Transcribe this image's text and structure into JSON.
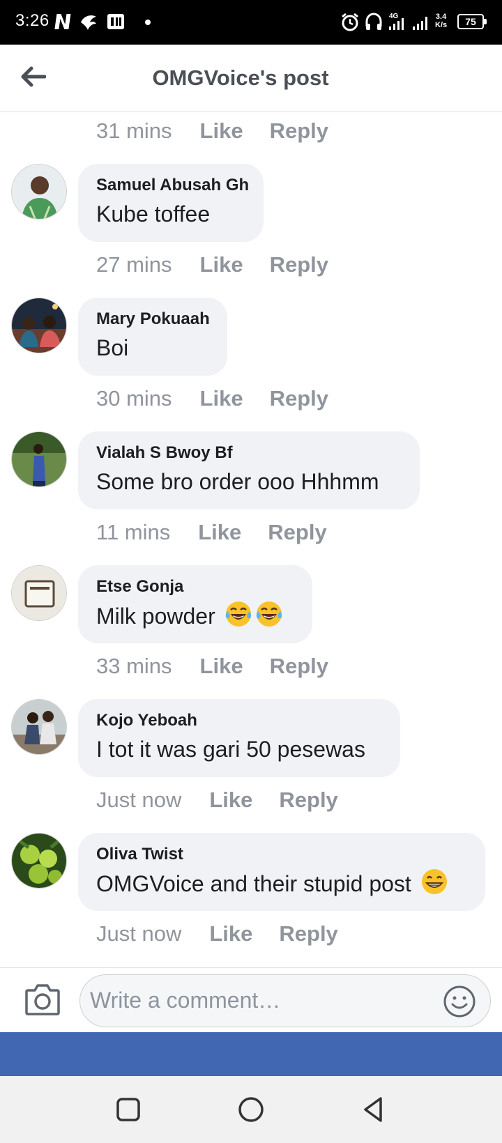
{
  "status_bar": {
    "time": "3:26",
    "network_type": "4G",
    "speed": "3.4",
    "speed_unit": "K/s",
    "battery": "75"
  },
  "header": {
    "title": "OMGVoice's post",
    "back_icon": "arrow-left-icon"
  },
  "top_meta": {
    "time": "31 mins",
    "like": "Like",
    "reply": "Reply"
  },
  "comments": [
    {
      "author": "Samuel Abusah Gh",
      "text": "Kube toffee",
      "time": "27 mins",
      "like": "Like",
      "reply": "Reply",
      "emojis": []
    },
    {
      "author": "Mary Pokuaah",
      "text": "Boi",
      "time": "30 mins",
      "like": "Like",
      "reply": "Reply",
      "emojis": []
    },
    {
      "author": "Vialah S Bwoy Bf",
      "text": "Some bro order ooo Hhhmm",
      "time": "11 mins",
      "like": "Like",
      "reply": "Reply",
      "emojis": []
    },
    {
      "author": "Etse Gonja",
      "text": "Milk powder",
      "time": "33 mins",
      "like": "Like",
      "reply": "Reply",
      "emojis": [
        "face-with-tears-of-joy",
        "face-with-tears-of-joy"
      ]
    },
    {
      "author": "Kojo Yeboah",
      "text": "I tot it was gari 50 pesewas",
      "time": "Just now",
      "like": "Like",
      "reply": "Reply",
      "emojis": []
    },
    {
      "author": "Oliva Twist",
      "text": "OMGVoice and their stupid post",
      "time": "Just now",
      "like": "Like",
      "reply": "Reply",
      "emojis": [
        "grinning-face"
      ]
    }
  ],
  "composer": {
    "placeholder": "Write a comment…",
    "camera_icon": "camera-icon",
    "emoji_icon": "smiley-icon"
  },
  "colors": {
    "brand_blue": "#4267b2",
    "bubble_bg": "#f0f2f5",
    "meta_gray": "#90949c",
    "title_gray": "#4b4f56"
  },
  "nav_bar": {
    "icons": [
      "square-icon",
      "circle-icon",
      "triangle-back-icon"
    ]
  }
}
